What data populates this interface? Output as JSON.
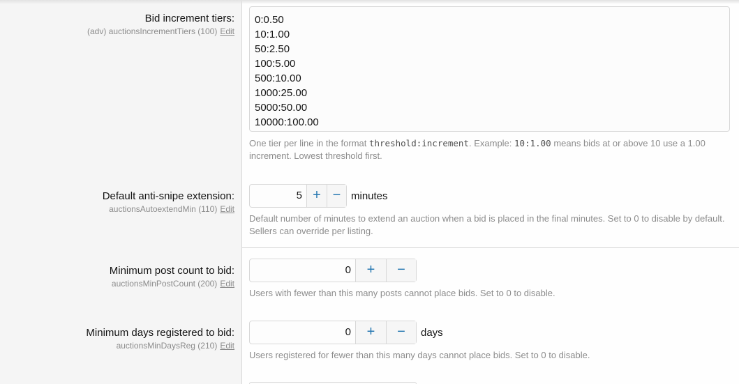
{
  "tiers": {
    "label": "Bid increment tiers:",
    "hint": "(adv) auctionsIncrementTiers (100)",
    "edit": "Edit",
    "lines": [
      "0:0.50",
      "10:1.00",
      "50:2.50",
      "100:5.00",
      "500:10.00",
      "1000:25.00",
      "5000:50.00",
      "10000:100.00"
    ],
    "explain": {
      "part1": "One tier per line in the format ",
      "code1": "threshold:increment",
      "part2": ". Example: ",
      "code2": "10:1.00",
      "part3": " means bids at or above 10 use a 1.00 increment. Lowest threshold first."
    }
  },
  "antisnipe": {
    "label": "Default anti-snipe extension:",
    "hint": "auctionsAutoextendMin (110)",
    "edit": "Edit",
    "value": "5",
    "plus": "+",
    "minus": "−",
    "unit": "minutes",
    "explain": "Default number of minutes to extend an auction when a bid is placed in the final minutes. Set to 0 to disable by default. Sellers can override per listing."
  },
  "minposts": {
    "label": "Minimum post count to bid:",
    "hint": "auctionsMinPostCount (200)",
    "edit": "Edit",
    "value": "0",
    "plus": "+",
    "minus": "−",
    "explain": "Users with fewer than this many posts cannot place bids. Set to 0 to disable."
  },
  "mindays": {
    "label": "Minimum days registered to bid:",
    "hint": "auctionsMinDaysReg (210)",
    "edit": "Edit",
    "value": "0",
    "plus": "+",
    "minus": "−",
    "unit": "days",
    "explain": "Users registered for fewer than this many days cannot place bids. Set to 0 to disable."
  }
}
